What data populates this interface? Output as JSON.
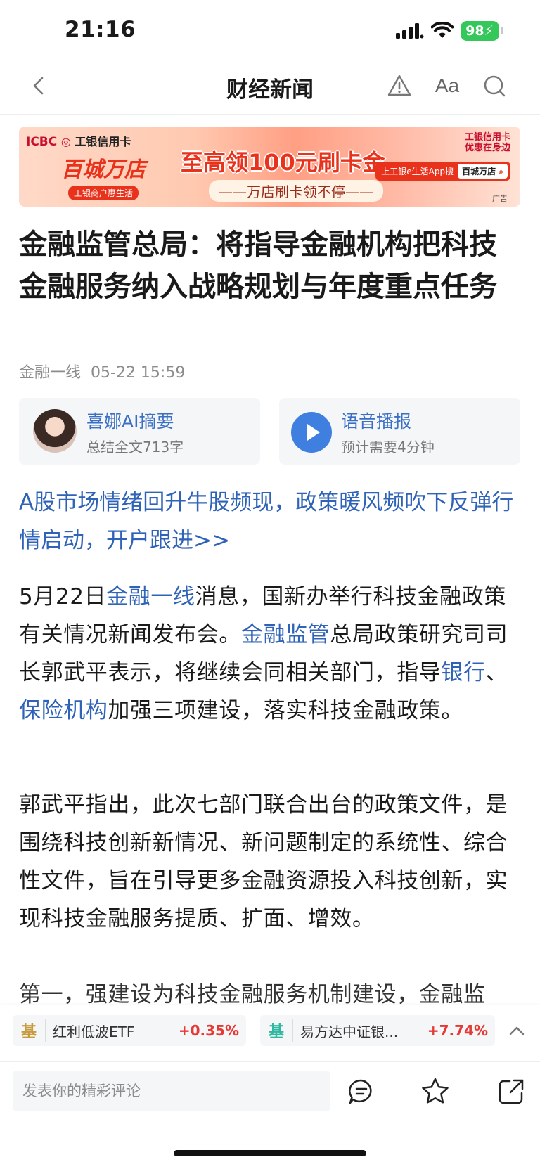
{
  "status_bar": {
    "time": "21:16",
    "battery": "98"
  },
  "nav": {
    "title": "财经新闻",
    "font_button": "Aa"
  },
  "ad": {
    "brand_icbc": "ICBC",
    "brand_text": "工银信用卡",
    "logo_text": "百城万店",
    "sub_text": "工银商户惠生活",
    "headline": "至高领100元刷卡金",
    "tagline": "——万店刷卡领不停——",
    "right_top": "工银信用卡\n优惠在身边",
    "search_label": "上工银e生活App搜",
    "search_box": "百城万店",
    "ad_mark": "广告"
  },
  "article": {
    "title": "金融监管总局：将指导金融机构把科技金融服务纳入战略规划与年度重点任务",
    "source": "金融一线",
    "time": "05-22 15:59"
  },
  "cards": {
    "ai": {
      "title": "喜娜AI摘要",
      "sub": "总结全文713字"
    },
    "audio": {
      "title": "语音播报",
      "sub": "预计需要4分钟"
    }
  },
  "promo": "A股市场情绪回升牛股频现，政策暖风频吹下反弹行情启动，开户跟进>>",
  "body": {
    "p1_a": "5月22日",
    "p1_link1": "金融一线",
    "p1_b": "消息，国新办举行科技金融政策有关情况新闻发布会。",
    "p1_link2": "金融监管",
    "p1_c": "总局政策研究司司长郭武平表示，将继续会同相关部门，指导",
    "p1_link3": "银行",
    "p1_d": "、",
    "p1_link4": "保险机构",
    "p1_e": "加强三项建设，落实科技金融政策。",
    "p2": "郭武平指出，此次七部门联合出台的政策文件，是围绕科技创新新情况、新问题制定的系统性、综合性文件，旨在引导更多金融资源投入科技创新，实现科技金融服务提质、扩面、增效。",
    "p3": "第一，强建设为科技金融服务机制建设，金融监"
  },
  "funds": [
    {
      "badge": "基",
      "name": "红利低波ETF",
      "change": "+0.35%",
      "badge_color": "#c79a3c"
    },
    {
      "badge": "基",
      "name": "易方达中证银...",
      "change": "+7.74%",
      "badge_color": "#2fb8a0"
    }
  ],
  "comment": {
    "placeholder": "发表你的精彩评论"
  }
}
